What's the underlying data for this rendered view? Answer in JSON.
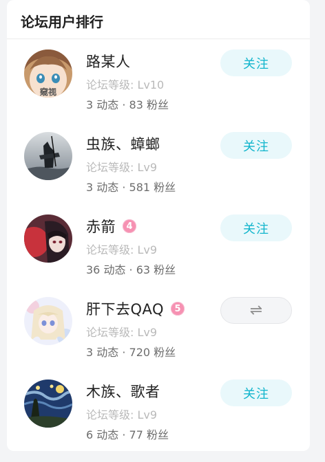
{
  "panel": {
    "title": "论坛用户排行"
  },
  "users": [
    {
      "name": "路某人",
      "level": "论坛等级: Lv10",
      "stats": "3 动态 · 83 粉丝",
      "follow": "关注",
      "avatar_caption": "窥视"
    },
    {
      "name": "虫族、蟑螂",
      "level": "论坛等级: Lv9",
      "stats": "3 动态 · 581 粉丝",
      "follow": "关注"
    },
    {
      "name": "赤箭",
      "badge": "4",
      "level": "论坛等级: Lv9",
      "stats": "36 动态 · 63 粉丝",
      "follow": "关注"
    },
    {
      "name": "肝下去QAQ",
      "badge": "5",
      "level": "论坛等级: Lv9",
      "stats": "3 动态 · 720 粉丝",
      "mutual_icon": "⇌"
    },
    {
      "name": "木族、歌者",
      "level": "论坛等级: Lv9",
      "stats": "6 动态 · 77 粉丝",
      "follow": "关注"
    }
  ],
  "colors": {
    "accent": "#11b5cc",
    "follow_bg": "#e9f8fb",
    "badge": "#f691b2",
    "level_text": "#b9b9b9"
  }
}
